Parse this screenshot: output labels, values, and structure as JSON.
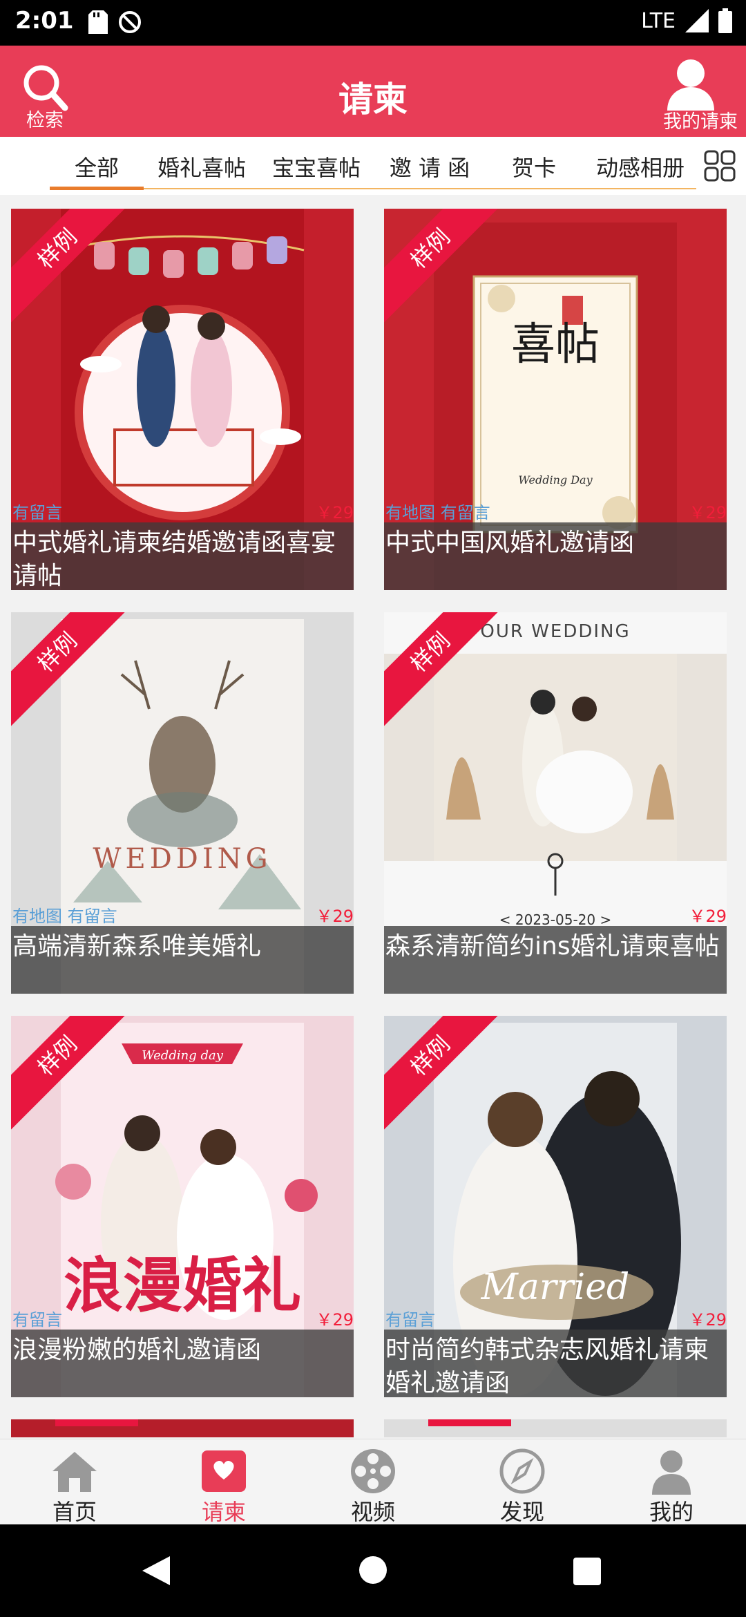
{
  "status_bar": {
    "time": "2:01",
    "network": "LTE"
  },
  "header": {
    "title": "请柬",
    "search_label": "检索",
    "user_label": "我的请柬"
  },
  "categories": [
    "全部",
    "婚礼喜帖",
    "宝宝喜帖",
    "邀 请 函",
    "贺卡",
    "动感相册"
  ],
  "sample_ribbon": "样例",
  "cards": [
    {
      "tags": "有留言",
      "price": "￥29",
      "title": "中式婚礼请柬结婚邀请函喜宴请帖"
    },
    {
      "tags": "有地图 有留言",
      "price": "￥29",
      "title": "中式中国风婚礼邀请函"
    },
    {
      "tags": "有地图 有留言",
      "price": "￥29",
      "title": "高端清新森系唯美婚礼"
    },
    {
      "tags": "",
      "price": "￥29",
      "title": "森系清新简约ins婚礼请柬喜帖"
    },
    {
      "tags": "有留言",
      "price": "￥29",
      "title": "浪漫粉嫩的婚礼邀请函"
    },
    {
      "tags": "有留言",
      "price": "￥29",
      "title": "时尚简约韩式杂志风婚礼请柬婚礼邀请函"
    }
  ],
  "card_art_text": {
    "card2_big": "喜帖",
    "card2_small": "Wedding Day",
    "card3_big": "WEDDING",
    "card4_top": "OUR WEDDING",
    "card4_date": "< 2023-05-20 >",
    "card5_big": "浪漫婚礼",
    "card5_top": "Wedding day",
    "card6_script": "Married"
  },
  "bottom_nav": [
    {
      "label": "首页",
      "icon": "home-icon"
    },
    {
      "label": "请柬",
      "icon": "invitation-icon"
    },
    {
      "label": "视频",
      "icon": "film-reel-icon"
    },
    {
      "label": "发现",
      "icon": "compass-icon"
    },
    {
      "label": "我的",
      "icon": "person-icon"
    }
  ],
  "colors": {
    "primary": "#e83d57",
    "accent_underline": "#e97c2c",
    "price": "#f21e3a",
    "tag": "#5a9fd6"
  }
}
